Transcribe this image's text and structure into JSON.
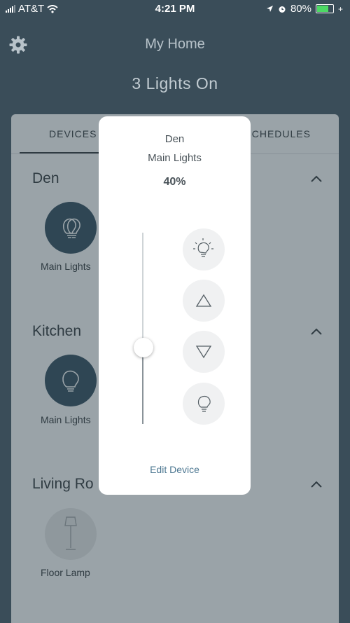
{
  "status_bar": {
    "carrier": "AT&T",
    "time": "4:21 PM",
    "battery": "80%"
  },
  "header": {
    "title": "My Home",
    "subtitle": "3 Lights On"
  },
  "tabs": {
    "devices": "DEVICES",
    "schedules": "SCHEDULES"
  },
  "rooms": [
    {
      "name": "Den",
      "device": "Main Lights"
    },
    {
      "name": "Kitchen",
      "device": "Main Lights"
    },
    {
      "name": "Living Ro",
      "device": "Floor Lamp"
    }
  ],
  "popup": {
    "room": "Den",
    "device": "Main Lights",
    "brightness_label": "40%",
    "brightness": 0.4,
    "edit_label": "Edit Device"
  },
  "icons": {
    "settings": "gear-icon",
    "bulb_on": "bulb-on-icon",
    "bulb_off": "bulb-off-icon",
    "increase": "triangle-up-icon",
    "decrease": "triangle-down-icon",
    "floor_lamp": "floor-lamp-icon",
    "collapse": "chevron-up-icon"
  },
  "colors": {
    "accent": "#4e7892",
    "header_bg": "#3a4d59",
    "bulb_active": "#2f4654"
  }
}
